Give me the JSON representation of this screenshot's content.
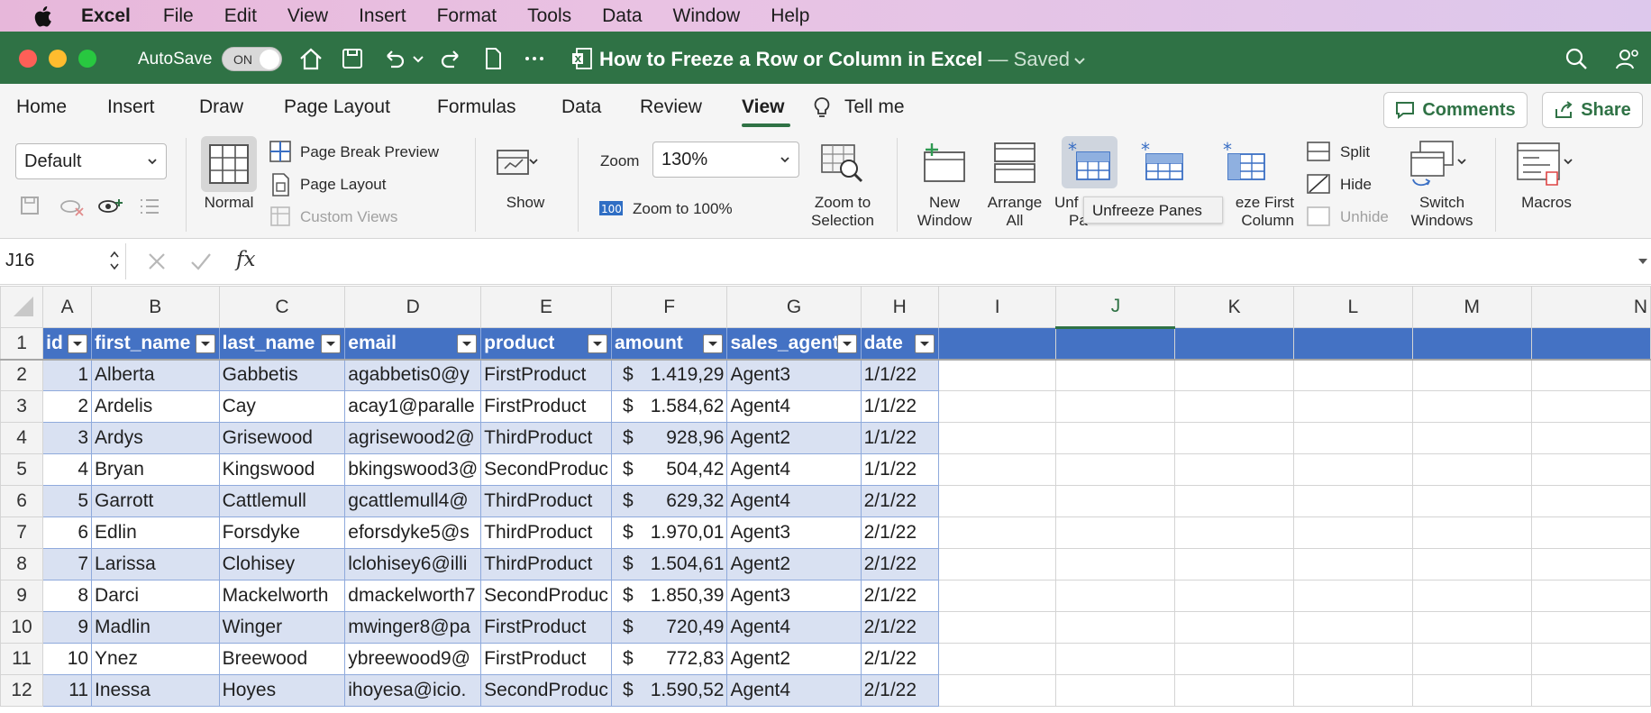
{
  "menubar": {
    "app": "Excel",
    "items": [
      "File",
      "Edit",
      "View",
      "Insert",
      "Format",
      "Tools",
      "Data",
      "Window",
      "Help"
    ]
  },
  "titlebar": {
    "autosave_label": "AutoSave",
    "autosave_state": "ON",
    "title": "How to Freeze a Row or Column in Excel",
    "saved": "— Saved"
  },
  "tabs": [
    "Home",
    "Insert",
    "Draw",
    "Page Layout",
    "Formulas",
    "Data",
    "Review",
    "View"
  ],
  "tell_me": "Tell me",
  "comments_label": "Comments",
  "share_label": "Share",
  "ribbon": {
    "sheet_view": "Default",
    "normal": "Normal",
    "page_break_preview": "Page Break Preview",
    "page_layout": "Page Layout",
    "custom_views": "Custom Views",
    "show": "Show",
    "zoom_label": "Zoom",
    "zoom_value": "130%",
    "zoom_100": "Zoom to 100%",
    "zoom_sel_1": "Zoom to",
    "zoom_sel_2": "Selection",
    "new_window_1": "New",
    "new_window_2": "Window",
    "arrange_1": "Arrange",
    "arrange_2": "All",
    "unfreeze_1": "Unf",
    "unfreeze_2": "Pa",
    "freeze_col_1": "eze First",
    "freeze_col_2": "Column",
    "split": "Split",
    "hide": "Hide",
    "unhide": "Unhide",
    "switch_1": "Switch",
    "switch_2": "Windows",
    "macros": "Macros",
    "tooltip": "Unfreeze Panes"
  },
  "formula": {
    "namebox": "J16",
    "fx": "fx"
  },
  "columns": [
    "A",
    "B",
    "C",
    "D",
    "E",
    "F",
    "G",
    "H",
    "I",
    "J",
    "K",
    "L",
    "M",
    "N"
  ],
  "headers": [
    "id",
    "first_name",
    "last_name",
    "email",
    "product",
    "amount",
    "sales_agent",
    "date"
  ],
  "rows": [
    {
      "n": "2",
      "id": "1",
      "first": "Alberta",
      "last": "Gabbetis",
      "email": "agabbetis0@y",
      "product": "FirstProduct",
      "cur": "$",
      "amount": "1.419,29",
      "agent": "Agent3",
      "date": "1/1/22"
    },
    {
      "n": "3",
      "id": "2",
      "first": "Ardelis",
      "last": "Cay",
      "email": "acay1@paralle",
      "product": "FirstProduct",
      "cur": "$",
      "amount": "1.584,62",
      "agent": "Agent4",
      "date": "1/1/22"
    },
    {
      "n": "4",
      "id": "3",
      "first": "Ardys",
      "last": "Grisewood",
      "email": "agrisewood2@",
      "product": "ThirdProduct",
      "cur": "$",
      "amount": "928,96",
      "agent": "Agent2",
      "date": "1/1/22"
    },
    {
      "n": "5",
      "id": "4",
      "first": "Bryan",
      "last": "Kingswood",
      "email": "bkingswood3@",
      "product": "SecondProduc",
      "cur": "$",
      "amount": "504,42",
      "agent": "Agent4",
      "date": "1/1/22"
    },
    {
      "n": "6",
      "id": "5",
      "first": "Garrott",
      "last": "Cattlemull",
      "email": "gcattlemull4@",
      "product": "ThirdProduct",
      "cur": "$",
      "amount": "629,32",
      "agent": "Agent4",
      "date": "2/1/22"
    },
    {
      "n": "7",
      "id": "6",
      "first": "Edlin",
      "last": "Forsdyke",
      "email": "eforsdyke5@s",
      "product": "ThirdProduct",
      "cur": "$",
      "amount": "1.970,01",
      "agent": "Agent3",
      "date": "2/1/22"
    },
    {
      "n": "8",
      "id": "7",
      "first": "Larissa",
      "last": "Clohisey",
      "email": "lclohisey6@illi",
      "product": "ThirdProduct",
      "cur": "$",
      "amount": "1.504,61",
      "agent": "Agent2",
      "date": "2/1/22"
    },
    {
      "n": "9",
      "id": "8",
      "first": "Darci",
      "last": "Mackelworth",
      "email": "dmackelworth7",
      "product": "SecondProduc",
      "cur": "$",
      "amount": "1.850,39",
      "agent": "Agent3",
      "date": "2/1/22"
    },
    {
      "n": "10",
      "id": "9",
      "first": "Madlin",
      "last": "Winger",
      "email": "mwinger8@pa",
      "product": "FirstProduct",
      "cur": "$",
      "amount": "720,49",
      "agent": "Agent4",
      "date": "2/1/22"
    },
    {
      "n": "11",
      "id": "10",
      "first": "Ynez",
      "last": "Breewood",
      "email": "ybreewood9@",
      "product": "FirstProduct",
      "cur": "$",
      "amount": "772,83",
      "agent": "Agent2",
      "date": "2/1/22"
    },
    {
      "n": "12",
      "id": "11",
      "first": "Inessa",
      "last": "Hoyes",
      "email": "ihoyesa@icio.",
      "product": "SecondProduc",
      "cur": "$",
      "amount": "1.590,52",
      "agent": "Agent4",
      "date": "2/1/22"
    }
  ],
  "colors": {
    "title_green": "#2f7245",
    "table_header": "#4472c4",
    "band": "#d9e1f2"
  }
}
